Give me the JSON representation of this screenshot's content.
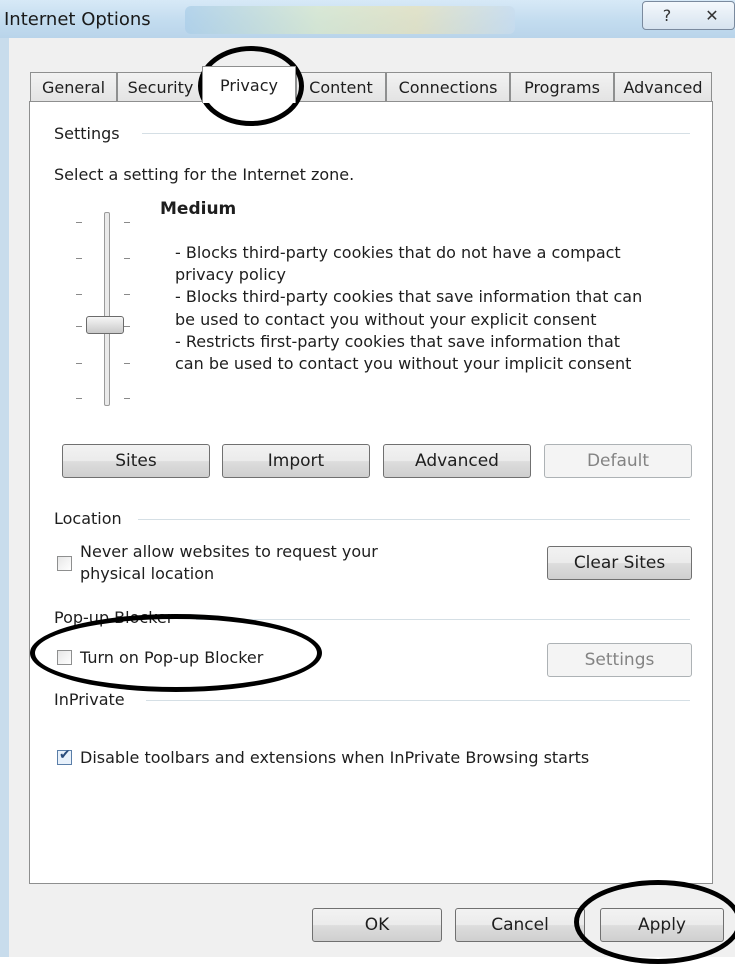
{
  "window": {
    "title": "Internet Options",
    "help_glyph": "?",
    "close_glyph": "✕"
  },
  "tabs": [
    {
      "label": "General"
    },
    {
      "label": "Security"
    },
    {
      "label": "Privacy",
      "selected": true
    },
    {
      "label": "Content"
    },
    {
      "label": "Connections"
    },
    {
      "label": "Programs"
    },
    {
      "label": "Advanced"
    }
  ],
  "settings": {
    "header": "Settings",
    "prompt": "Select a setting for the Internet zone.",
    "level_name": "Medium",
    "slider_position": "3 of 6",
    "description_lines": [
      "- Blocks third-party cookies that do not have a compact",
      "privacy policy",
      "- Blocks third-party cookies that save information that can",
      "be used to contact you without your explicit consent",
      "- Restricts first-party cookies that save information that",
      "can be used to contact you without your implicit consent"
    ],
    "buttons": {
      "sites": "Sites",
      "import": "Import",
      "advanced": "Advanced",
      "default": "Default"
    }
  },
  "location": {
    "header": "Location",
    "checkbox_line1": "Never allow websites to request your",
    "checkbox_line2": "physical location",
    "checked": false,
    "clear_sites": "Clear Sites"
  },
  "popup": {
    "header": "Pop-up Blocker",
    "checkbox_label": "Turn on Pop-up Blocker",
    "checked": false,
    "settings_button": "Settings"
  },
  "inprivate": {
    "header": "InPrivate",
    "checkbox_label": "Disable toolbars and extensions when InPrivate Browsing starts",
    "checked": true
  },
  "footer": {
    "ok": "OK",
    "cancel": "Cancel",
    "apply": "Apply"
  },
  "colors": {
    "titlebar": "#c3dcef",
    "dialog_bg": "#f0f0f0",
    "annotation_ring": "#000000"
  }
}
